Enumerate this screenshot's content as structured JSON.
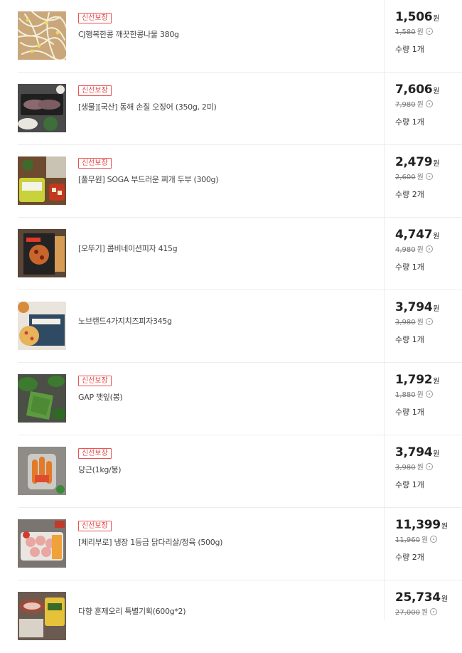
{
  "items": [
    {
      "badge": "신선보장",
      "name": "CJ행복한콩 깨끗한콩나물 380g",
      "price": "1,506",
      "won": "원",
      "original": "1,580",
      "original_won": "원",
      "qty": "수량 1개",
      "image": "bean-sprouts"
    },
    {
      "badge": "신선보장",
      "name": "[생물][국산] 동해 손질 오징어 (350g, 2미)",
      "price": "7,606",
      "won": "원",
      "original": "7,980",
      "original_won": "원",
      "qty": "수량 1개",
      "image": "squid-tray"
    },
    {
      "badge": "신선보장",
      "name": "[풀무원] SOGA 부드러운 찌개 두부 (300g)",
      "price": "2,479",
      "won": "원",
      "original": "2,600",
      "original_won": "원",
      "qty": "수량 2개",
      "image": "tofu-pack"
    },
    {
      "badge": "",
      "name": "[오뚜기] 콤비네이션피자 415g",
      "price": "4,747",
      "won": "원",
      "original": "4,980",
      "original_won": "원",
      "qty": "수량 1개",
      "image": "combination-pizza-box"
    },
    {
      "badge": "",
      "name": "노브랜드4가지치즈피자345g",
      "price": "3,794",
      "won": "원",
      "original": "3,980",
      "original_won": "원",
      "qty": "수량 1개",
      "image": "cheese-pizza-box"
    },
    {
      "badge": "신선보장",
      "name": "GAP 깻잎(봉)",
      "price": "1,792",
      "won": "원",
      "original": "1,880",
      "original_won": "원",
      "qty": "수량 1개",
      "image": "perilla-leaves"
    },
    {
      "badge": "신선보장",
      "name": "당근(1kg/봉)",
      "price": "3,794",
      "won": "원",
      "original": "3,980",
      "original_won": "원",
      "qty": "수량 1개",
      "image": "carrot-bag"
    },
    {
      "badge": "신선보장",
      "name": "[체리부로] 냉장 1등급 닭다리살/정육 (500g)",
      "price": "11,399",
      "won": "원",
      "original": "11,960",
      "original_won": "원",
      "qty": "수량 2개",
      "image": "chicken-thigh-pack"
    },
    {
      "badge": "",
      "name": "다향 훈제오리 특별기획(600g*2)",
      "price": "25,734",
      "won": "원",
      "original": "27,000",
      "original_won": "원",
      "qty": "",
      "image": "smoked-duck"
    }
  ],
  "colors": {
    "badge": "#e24848",
    "border": "#ececec",
    "price": "#222222"
  }
}
